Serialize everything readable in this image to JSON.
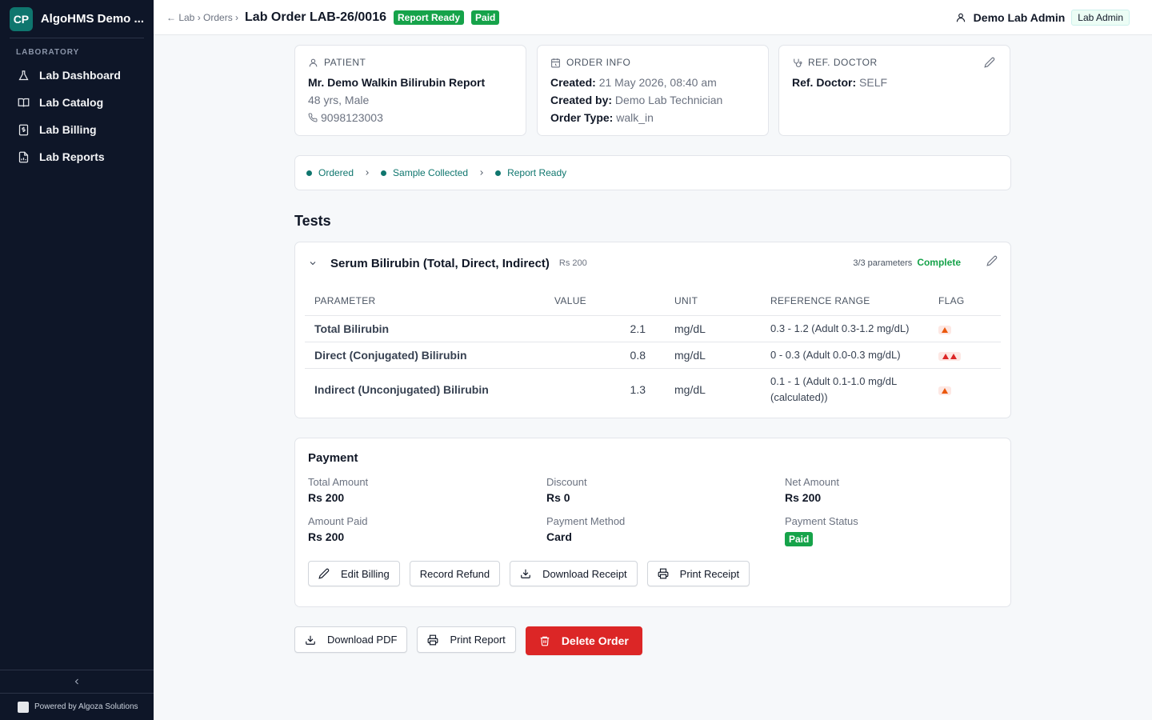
{
  "sidebar": {
    "brand_logo": "CP",
    "brand_name": "AlgoHMS Demo ...",
    "section_label": "LABORATORY",
    "items": [
      {
        "label": "Lab Dashboard",
        "icon": "flask-icon"
      },
      {
        "label": "Lab Catalog",
        "icon": "book-icon"
      },
      {
        "label": "Lab Billing",
        "icon": "dollar-receipt-icon"
      },
      {
        "label": "Lab Reports",
        "icon": "report-icon"
      }
    ],
    "powered_by": "Powered by Algoza Solutions"
  },
  "header": {
    "breadcrumb": "← Lab › Orders ›",
    "title": "Lab Order LAB-26/0016",
    "status_badge": "Report Ready",
    "payment_badge": "Paid",
    "user_name": "Demo Lab Admin",
    "user_role": "Lab Admin"
  },
  "patient": {
    "heading": "PATIENT",
    "name": "Mr. Demo Walkin Bilirubin Report",
    "age_gender": "48 yrs, Male",
    "phone": "9098123003"
  },
  "order_info": {
    "heading": "ORDER INFO",
    "created_label": "Created:",
    "created_value": "21 May 2026, 08:40 am",
    "created_by_label": "Created by:",
    "created_by_value": "Demo Lab Technician",
    "order_type_label": "Order Type:",
    "order_type_value": "walk_in"
  },
  "ref_doctor": {
    "heading": "REF. DOCTOR",
    "label": "Ref. Doctor:",
    "value": "SELF"
  },
  "steps": [
    "Ordered",
    "Sample Collected",
    "Report Ready"
  ],
  "tests": {
    "section_title": "Tests",
    "test_name": "Serum Bilirubin (Total, Direct, Indirect)",
    "price": "Rs 200",
    "param_count": "3/3 parameters",
    "status": "Complete",
    "columns": [
      "PARAMETER",
      "VALUE",
      "UNIT",
      "REFERENCE RANGE",
      "FLAG"
    ],
    "rows": [
      {
        "parameter": "Total Bilirubin",
        "value": "2.1",
        "unit": "mg/dL",
        "range": "0.3 - 1.2 (Adult 0.3-1.2 mg/dL)",
        "flag": "high"
      },
      {
        "parameter": "Direct (Conjugated) Bilirubin",
        "value": "0.8",
        "unit": "mg/dL",
        "range": "0 - 0.3 (Adult 0.0-0.3 mg/dL)",
        "flag": "critical-high"
      },
      {
        "parameter": "Indirect (Unconjugated) Bilirubin",
        "value": "1.3",
        "unit": "mg/dL",
        "range": "0.1 - 1 (Adult 0.1-1.0 mg/dL (calculated))",
        "flag": "high"
      }
    ]
  },
  "payment": {
    "title": "Payment",
    "total_amount_label": "Total Amount",
    "total_amount": "Rs 200",
    "discount_label": "Discount",
    "discount": "Rs 0",
    "net_amount_label": "Net Amount",
    "net_amount": "Rs 200",
    "amount_paid_label": "Amount Paid",
    "amount_paid": "Rs 200",
    "payment_method_label": "Payment Method",
    "payment_method": "Card",
    "payment_status_label": "Payment Status",
    "payment_status": "Paid",
    "buttons": {
      "edit_billing": "Edit Billing",
      "record_refund": "Record Refund",
      "download_receipt": "Download Receipt",
      "print_receipt": "Print Receipt"
    }
  },
  "actions": {
    "download_pdf": "Download PDF",
    "print_report": "Print Report",
    "delete_order": "Delete Order"
  },
  "colors": {
    "sidebar_bg": "#0e1628",
    "accent": "#0f766e",
    "success": "#16a34a",
    "danger": "#dc2626"
  }
}
